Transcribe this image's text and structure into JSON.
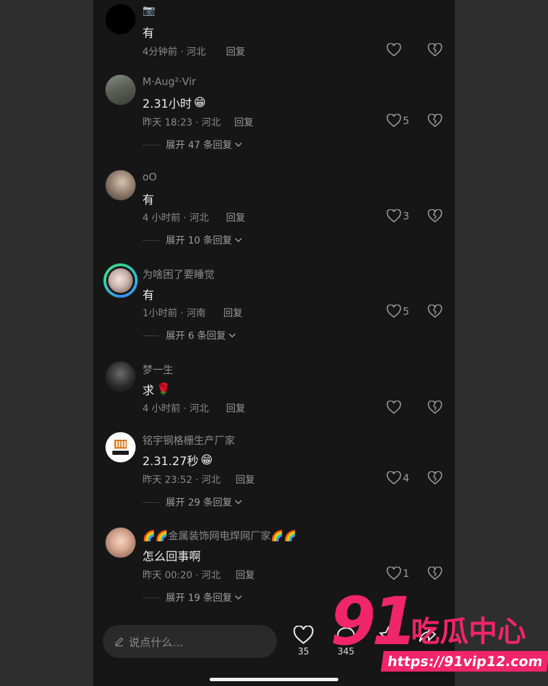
{
  "comments": [
    {
      "username": "📷",
      "text": "有",
      "emoji": "",
      "time_location": "4分钟前 · 河北",
      "reply": "回复",
      "likes": "",
      "expand": ""
    },
    {
      "username": "M·Aug²·Vir",
      "text": "2.31小时",
      "emoji": "😁",
      "time_location": "昨天 18:23 · 河北",
      "reply": "回复",
      "likes": "5",
      "expand": "展开 47 条回复"
    },
    {
      "username": "oO",
      "text": "有",
      "emoji": "",
      "time_location": "4 小时前 · 河北",
      "reply": "回复",
      "likes": "3",
      "expand": "展开 10 条回复"
    },
    {
      "username": "为啥困了要睡觉",
      "text": "有",
      "emoji": "",
      "time_location": "1小时前 · 河南",
      "reply": "回复",
      "likes": "5",
      "expand": "展开 6 条回复"
    },
    {
      "username": "梦一生",
      "text": "求",
      "emoji": "🌹",
      "time_location": "4 小时前 · 河北",
      "reply": "回复",
      "likes": "",
      "expand": ""
    },
    {
      "username": "铭宇钢格栅生产厂家",
      "text": "2.31.27秒",
      "emoji": "😁",
      "time_location": "昨天 23:52 · 河北",
      "reply": "回复",
      "likes": "4",
      "expand": "展开 29 条回复"
    },
    {
      "username": "🌈🌈金属装饰网电焊网厂家🌈🌈",
      "text": "怎么回事啊",
      "emoji": "",
      "time_location": "昨天 00:20 · 河北",
      "reply": "回复",
      "likes": "1",
      "expand": "展开 19 条回复"
    }
  ],
  "bottom_bar": {
    "input_placeholder": "说点什么...",
    "like_count": "35",
    "comment_count": "345"
  },
  "watermark": {
    "number": "91",
    "brand": "吃瓜中心",
    "url": "https://91vip12.com"
  },
  "icons": {
    "like": "heart-outline-icon",
    "dislike": "broken-heart-icon",
    "expand": "chevron-down-icon",
    "input": "pencil-icon"
  },
  "colors": {
    "background": "#161616",
    "watermark": "#f0256a"
  }
}
